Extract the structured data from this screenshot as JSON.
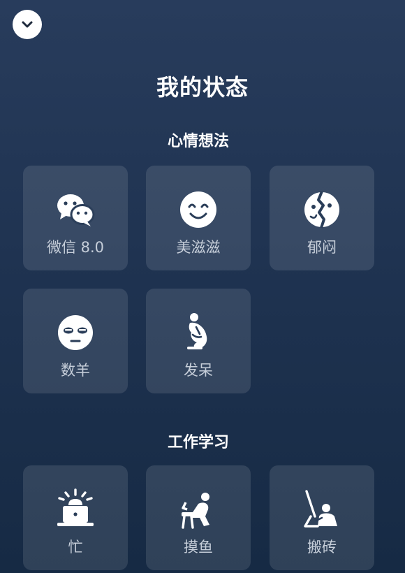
{
  "header": {
    "collapse_icon": "chevron-down-icon",
    "title": "我的状态"
  },
  "sections": [
    {
      "title": "心情想法",
      "items": [
        {
          "label": "微信 8.0",
          "icon": "wechat-icon"
        },
        {
          "label": "美滋滋",
          "icon": "smiley-face-icon"
        },
        {
          "label": "郁闷",
          "icon": "gloomy-face-icon"
        },
        {
          "label": "数羊",
          "icon": "sleepy-face-icon"
        },
        {
          "label": "发呆",
          "icon": "daze-figure-icon"
        }
      ]
    },
    {
      "title": "工作学习",
      "items": [
        {
          "label": "忙",
          "icon": "busy-laptop-icon"
        },
        {
          "label": "摸鱼",
          "icon": "slacking-figure-icon"
        },
        {
          "label": "搬砖",
          "icon": "working-figure-icon"
        }
      ]
    }
  ],
  "colors": {
    "background_top": "#283c5c",
    "background_bottom": "#162a44",
    "tile": "#3a4c66",
    "label": "#c6ced9"
  }
}
